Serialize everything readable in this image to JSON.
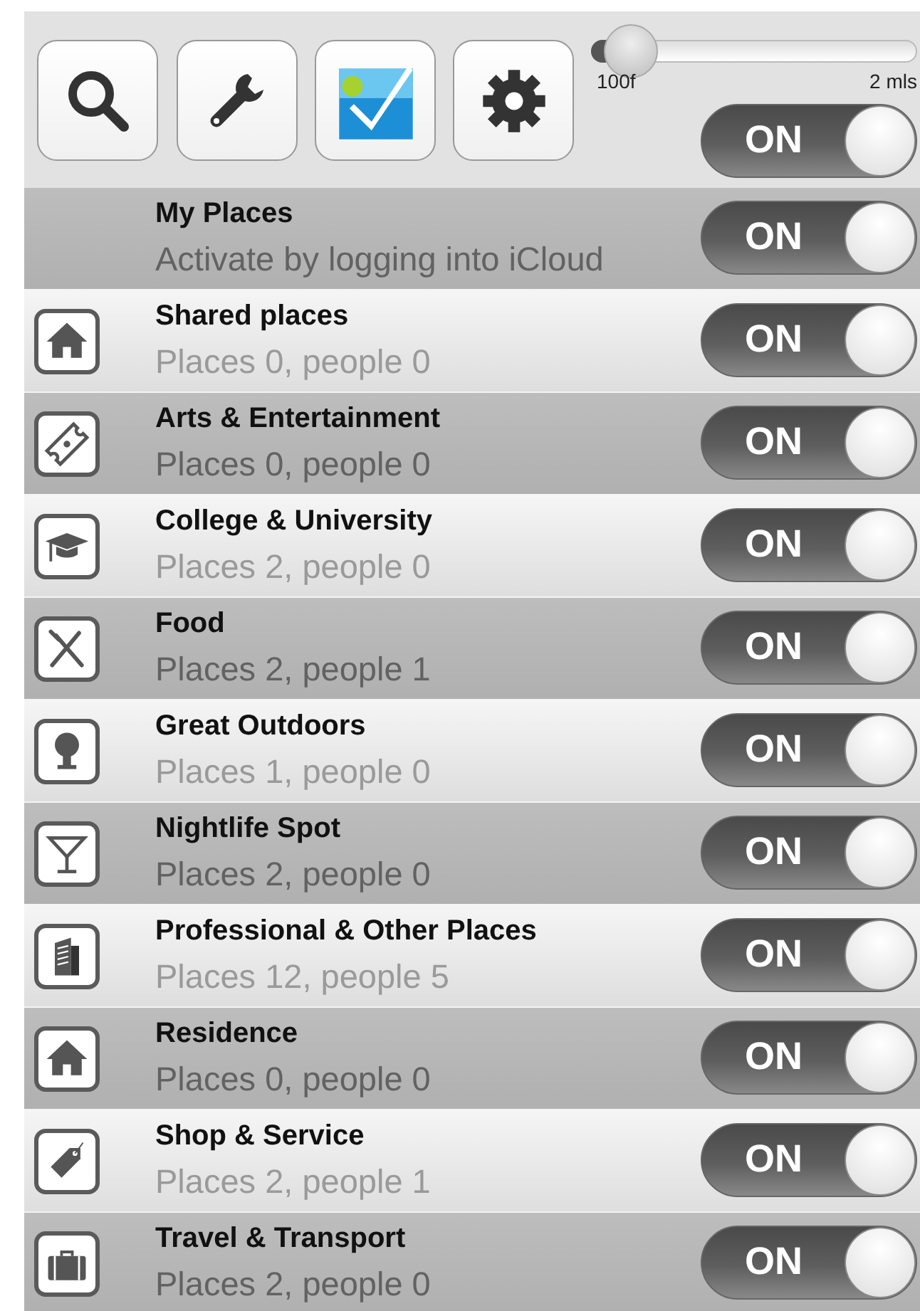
{
  "slider": {
    "min_label": "100f",
    "max_label": "2 mls",
    "level": 0.05
  },
  "master_toggle": {
    "label": "ON",
    "on": true
  },
  "rows": [
    {
      "title": "My Places",
      "subtitle": "Activate by logging into iCloud",
      "toggle": {
        "label": "ON",
        "on": true
      }
    },
    {
      "title": "Shared places",
      "subtitle": "Places 0, people 0",
      "toggle": {
        "label": "ON",
        "on": true
      }
    },
    {
      "title": "Arts & Entertainment",
      "subtitle": "Places 0, people 0",
      "toggle": {
        "label": "ON",
        "on": true
      }
    },
    {
      "title": "College & University",
      "subtitle": "Places 2, people 0",
      "toggle": {
        "label": "ON",
        "on": true
      }
    },
    {
      "title": "Food",
      "subtitle": "Places 2, people 1",
      "toggle": {
        "label": "ON",
        "on": true
      }
    },
    {
      "title": "Great Outdoors",
      "subtitle": "Places 1, people 0",
      "toggle": {
        "label": "ON",
        "on": true
      }
    },
    {
      "title": "Nightlife Spot",
      "subtitle": "Places 2, people 0",
      "toggle": {
        "label": "ON",
        "on": true
      }
    },
    {
      "title": "Professional & Other Places",
      "subtitle": "Places 12, people 5",
      "toggle": {
        "label": "ON",
        "on": true
      }
    },
    {
      "title": "Residence",
      "subtitle": "Places 0, people 0",
      "toggle": {
        "label": "ON",
        "on": true
      }
    },
    {
      "title": "Shop & Service",
      "subtitle": "Places 2, people 1",
      "toggle": {
        "label": "ON",
        "on": true
      }
    },
    {
      "title": "Travel & Transport",
      "subtitle": "Places 2, people 0",
      "toggle": {
        "label": "ON",
        "on": true
      }
    }
  ]
}
